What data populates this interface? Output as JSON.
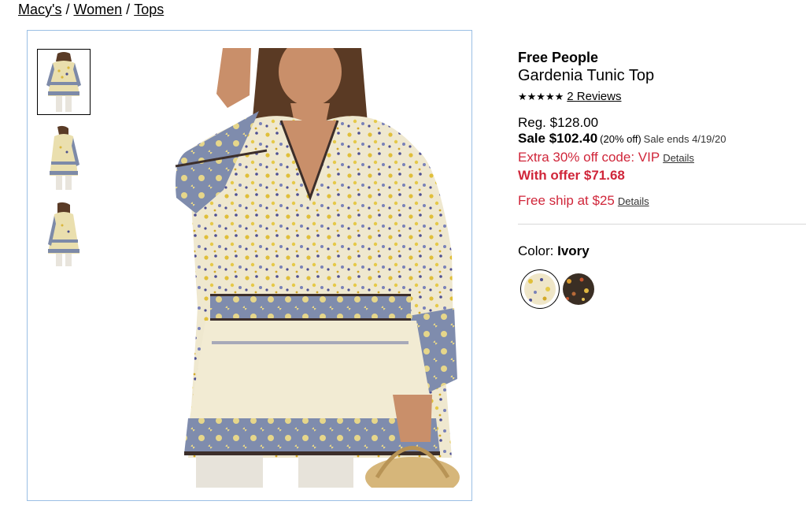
{
  "breadcrumb": {
    "items": [
      "Macy's",
      "Women",
      "Tops"
    ],
    "separator": "/"
  },
  "gallery": {
    "thumbnails": [
      {
        "label": "front view",
        "selected": true
      },
      {
        "label": "side view",
        "selected": false
      },
      {
        "label": "back view",
        "selected": false
      }
    ]
  },
  "product": {
    "brand": "Free People",
    "name": "Gardenia Tunic Top",
    "stars": "★★★★★",
    "reviews_label": "2 Reviews",
    "reg_price": "Reg. $128.00",
    "sale_label": "Sale $102.40",
    "sale_percent": "(20% off)",
    "sale_ends": "Sale ends 4/19/20",
    "promo_text": "Extra 30% off code: VIP",
    "promo_details": "Details",
    "offer_price": "With offer $71.68",
    "ship_text": "Free ship at $25",
    "ship_details": "Details",
    "color_label": "Color:",
    "color_value": "Ivory",
    "swatches": [
      {
        "name": "Ivory",
        "selected": true,
        "color": "#efe6c8"
      },
      {
        "name": "Dark floral",
        "selected": false,
        "color": "#3a2e24"
      }
    ]
  },
  "colors": {
    "accent_red": "#d0263a",
    "gallery_border": "#9bbfe4"
  }
}
